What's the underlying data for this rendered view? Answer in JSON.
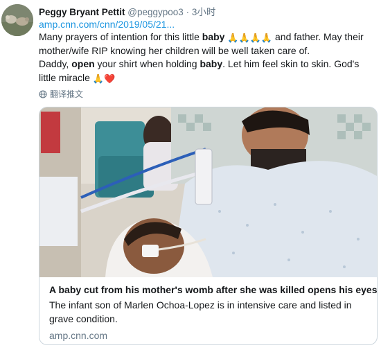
{
  "tweet": {
    "display_name": "Peggy Bryant Pettit",
    "handle": "@peggypoo3",
    "separator": "·",
    "time": "3小时",
    "link": "amp.cnn.com/cnn/2019/05/21...",
    "line1_a": "Many prayers of intention for this little ",
    "line1_bold": "baby",
    "line1_emoji": "🙏🙏🙏🙏",
    "line1_b": " and father. May their mother/wife RIP knowing her children will be well taken care of.",
    "line2_a": "Daddy, ",
    "line2_bold1": "open",
    "line2_b": " your shirt when holding ",
    "line2_bold2": "baby",
    "line2_c": ". Let him feel skin to skin. God's little miracle ",
    "line2_emoji": "🙏❤️",
    "translate_label": "翻译推文"
  },
  "card": {
    "title": "A baby cut from his mother's womb after she was killed opens his eyes",
    "description": "The infant son of Marlen Ochoa-Lopez is in intensive care and listed in grave condition.",
    "domain": "amp.cnn.com"
  },
  "colors": {
    "link": "#1b95e0",
    "secondary": "#657786",
    "border": "#ccd6dd",
    "heart": "#e0245e",
    "pray": "#f4b400"
  },
  "icons": {
    "avatar": "avatar-photo",
    "translate": "globe-icon"
  }
}
